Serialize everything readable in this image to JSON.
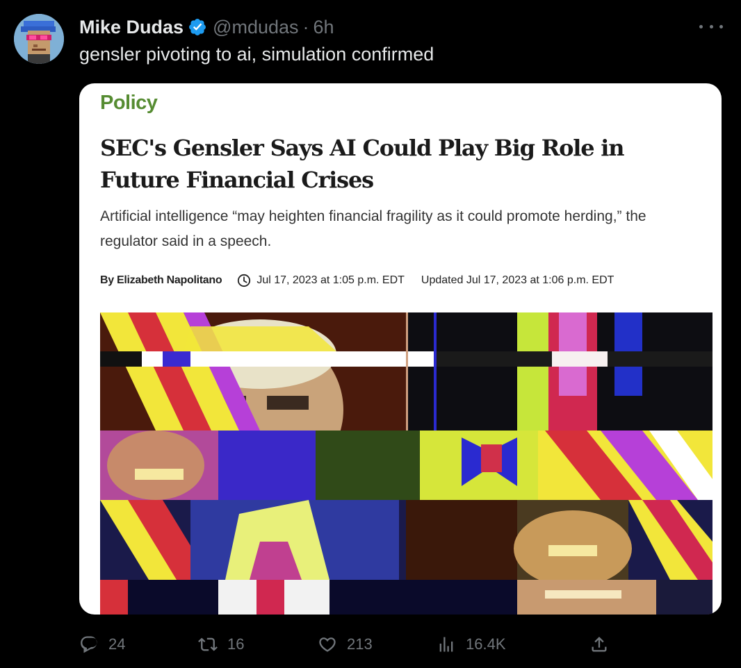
{
  "tweet": {
    "author_name": "Mike Dudas",
    "handle": "@mdudas",
    "separator": "·",
    "age": "6h",
    "text": "gensler pivoting to ai, simulation confirmed"
  },
  "card": {
    "category": "Policy",
    "headline": "SEC's Gensler Says AI Could Play Big Role in Future Financial Crises",
    "summary": "Artificial intelligence “may heighten financial fragility as it could promote herding,” the regulator said in a speech.",
    "byline": "By Elizabeth Napolitano",
    "published": "Jul 17, 2023 at 1:05 p.m. EDT",
    "updated": "Updated Jul 17, 2023 at 1:06 p.m. EDT"
  },
  "actions": {
    "replies": "24",
    "reposts": "16",
    "likes": "213",
    "views": "16.4K"
  },
  "icons": {
    "verified": "verified-badge-icon",
    "more": "more-options-icon",
    "clock": "clock-icon",
    "reply": "reply-icon",
    "repost": "repost-icon",
    "like": "heart-icon",
    "views": "views-chart-icon",
    "share": "share-icon"
  },
  "colors": {
    "background": "#000000",
    "text_primary": "#e7e9ea",
    "text_secondary": "#71767b",
    "verified_blue": "#1d9bf0",
    "category_green": "#568c32"
  }
}
